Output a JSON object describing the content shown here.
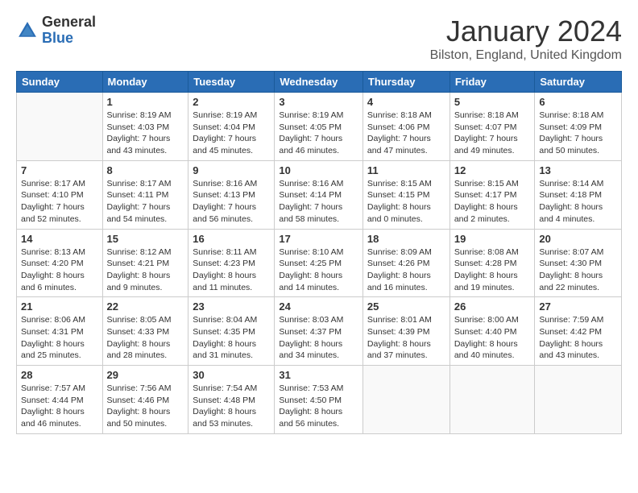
{
  "header": {
    "logo_general": "General",
    "logo_blue": "Blue",
    "title": "January 2024",
    "location": "Bilston, England, United Kingdom"
  },
  "days_of_week": [
    "Sunday",
    "Monday",
    "Tuesday",
    "Wednesday",
    "Thursday",
    "Friday",
    "Saturday"
  ],
  "weeks": [
    [
      {
        "num": "",
        "sunrise": "",
        "sunset": "",
        "daylight": "",
        "empty": true
      },
      {
        "num": "1",
        "sunrise": "Sunrise: 8:19 AM",
        "sunset": "Sunset: 4:03 PM",
        "daylight": "Daylight: 7 hours and 43 minutes."
      },
      {
        "num": "2",
        "sunrise": "Sunrise: 8:19 AM",
        "sunset": "Sunset: 4:04 PM",
        "daylight": "Daylight: 7 hours and 45 minutes."
      },
      {
        "num": "3",
        "sunrise": "Sunrise: 8:19 AM",
        "sunset": "Sunset: 4:05 PM",
        "daylight": "Daylight: 7 hours and 46 minutes."
      },
      {
        "num": "4",
        "sunrise": "Sunrise: 8:18 AM",
        "sunset": "Sunset: 4:06 PM",
        "daylight": "Daylight: 7 hours and 47 minutes."
      },
      {
        "num": "5",
        "sunrise": "Sunrise: 8:18 AM",
        "sunset": "Sunset: 4:07 PM",
        "daylight": "Daylight: 7 hours and 49 minutes."
      },
      {
        "num": "6",
        "sunrise": "Sunrise: 8:18 AM",
        "sunset": "Sunset: 4:09 PM",
        "daylight": "Daylight: 7 hours and 50 minutes."
      }
    ],
    [
      {
        "num": "7",
        "sunrise": "Sunrise: 8:17 AM",
        "sunset": "Sunset: 4:10 PM",
        "daylight": "Daylight: 7 hours and 52 minutes."
      },
      {
        "num": "8",
        "sunrise": "Sunrise: 8:17 AM",
        "sunset": "Sunset: 4:11 PM",
        "daylight": "Daylight: 7 hours and 54 minutes."
      },
      {
        "num": "9",
        "sunrise": "Sunrise: 8:16 AM",
        "sunset": "Sunset: 4:13 PM",
        "daylight": "Daylight: 7 hours and 56 minutes."
      },
      {
        "num": "10",
        "sunrise": "Sunrise: 8:16 AM",
        "sunset": "Sunset: 4:14 PM",
        "daylight": "Daylight: 7 hours and 58 minutes."
      },
      {
        "num": "11",
        "sunrise": "Sunrise: 8:15 AM",
        "sunset": "Sunset: 4:15 PM",
        "daylight": "Daylight: 8 hours and 0 minutes."
      },
      {
        "num": "12",
        "sunrise": "Sunrise: 8:15 AM",
        "sunset": "Sunset: 4:17 PM",
        "daylight": "Daylight: 8 hours and 2 minutes."
      },
      {
        "num": "13",
        "sunrise": "Sunrise: 8:14 AM",
        "sunset": "Sunset: 4:18 PM",
        "daylight": "Daylight: 8 hours and 4 minutes."
      }
    ],
    [
      {
        "num": "14",
        "sunrise": "Sunrise: 8:13 AM",
        "sunset": "Sunset: 4:20 PM",
        "daylight": "Daylight: 8 hours and 6 minutes."
      },
      {
        "num": "15",
        "sunrise": "Sunrise: 8:12 AM",
        "sunset": "Sunset: 4:21 PM",
        "daylight": "Daylight: 8 hours and 9 minutes."
      },
      {
        "num": "16",
        "sunrise": "Sunrise: 8:11 AM",
        "sunset": "Sunset: 4:23 PM",
        "daylight": "Daylight: 8 hours and 11 minutes."
      },
      {
        "num": "17",
        "sunrise": "Sunrise: 8:10 AM",
        "sunset": "Sunset: 4:25 PM",
        "daylight": "Daylight: 8 hours and 14 minutes."
      },
      {
        "num": "18",
        "sunrise": "Sunrise: 8:09 AM",
        "sunset": "Sunset: 4:26 PM",
        "daylight": "Daylight: 8 hours and 16 minutes."
      },
      {
        "num": "19",
        "sunrise": "Sunrise: 8:08 AM",
        "sunset": "Sunset: 4:28 PM",
        "daylight": "Daylight: 8 hours and 19 minutes."
      },
      {
        "num": "20",
        "sunrise": "Sunrise: 8:07 AM",
        "sunset": "Sunset: 4:30 PM",
        "daylight": "Daylight: 8 hours and 22 minutes."
      }
    ],
    [
      {
        "num": "21",
        "sunrise": "Sunrise: 8:06 AM",
        "sunset": "Sunset: 4:31 PM",
        "daylight": "Daylight: 8 hours and 25 minutes."
      },
      {
        "num": "22",
        "sunrise": "Sunrise: 8:05 AM",
        "sunset": "Sunset: 4:33 PM",
        "daylight": "Daylight: 8 hours and 28 minutes."
      },
      {
        "num": "23",
        "sunrise": "Sunrise: 8:04 AM",
        "sunset": "Sunset: 4:35 PM",
        "daylight": "Daylight: 8 hours and 31 minutes."
      },
      {
        "num": "24",
        "sunrise": "Sunrise: 8:03 AM",
        "sunset": "Sunset: 4:37 PM",
        "daylight": "Daylight: 8 hours and 34 minutes."
      },
      {
        "num": "25",
        "sunrise": "Sunrise: 8:01 AM",
        "sunset": "Sunset: 4:39 PM",
        "daylight": "Daylight: 8 hours and 37 minutes."
      },
      {
        "num": "26",
        "sunrise": "Sunrise: 8:00 AM",
        "sunset": "Sunset: 4:40 PM",
        "daylight": "Daylight: 8 hours and 40 minutes."
      },
      {
        "num": "27",
        "sunrise": "Sunrise: 7:59 AM",
        "sunset": "Sunset: 4:42 PM",
        "daylight": "Daylight: 8 hours and 43 minutes."
      }
    ],
    [
      {
        "num": "28",
        "sunrise": "Sunrise: 7:57 AM",
        "sunset": "Sunset: 4:44 PM",
        "daylight": "Daylight: 8 hours and 46 minutes."
      },
      {
        "num": "29",
        "sunrise": "Sunrise: 7:56 AM",
        "sunset": "Sunset: 4:46 PM",
        "daylight": "Daylight: 8 hours and 50 minutes."
      },
      {
        "num": "30",
        "sunrise": "Sunrise: 7:54 AM",
        "sunset": "Sunset: 4:48 PM",
        "daylight": "Daylight: 8 hours and 53 minutes."
      },
      {
        "num": "31",
        "sunrise": "Sunrise: 7:53 AM",
        "sunset": "Sunset: 4:50 PM",
        "daylight": "Daylight: 8 hours and 56 minutes."
      },
      {
        "num": "",
        "sunrise": "",
        "sunset": "",
        "daylight": "",
        "empty": true
      },
      {
        "num": "",
        "sunrise": "",
        "sunset": "",
        "daylight": "",
        "empty": true
      },
      {
        "num": "",
        "sunrise": "",
        "sunset": "",
        "daylight": "",
        "empty": true
      }
    ]
  ]
}
